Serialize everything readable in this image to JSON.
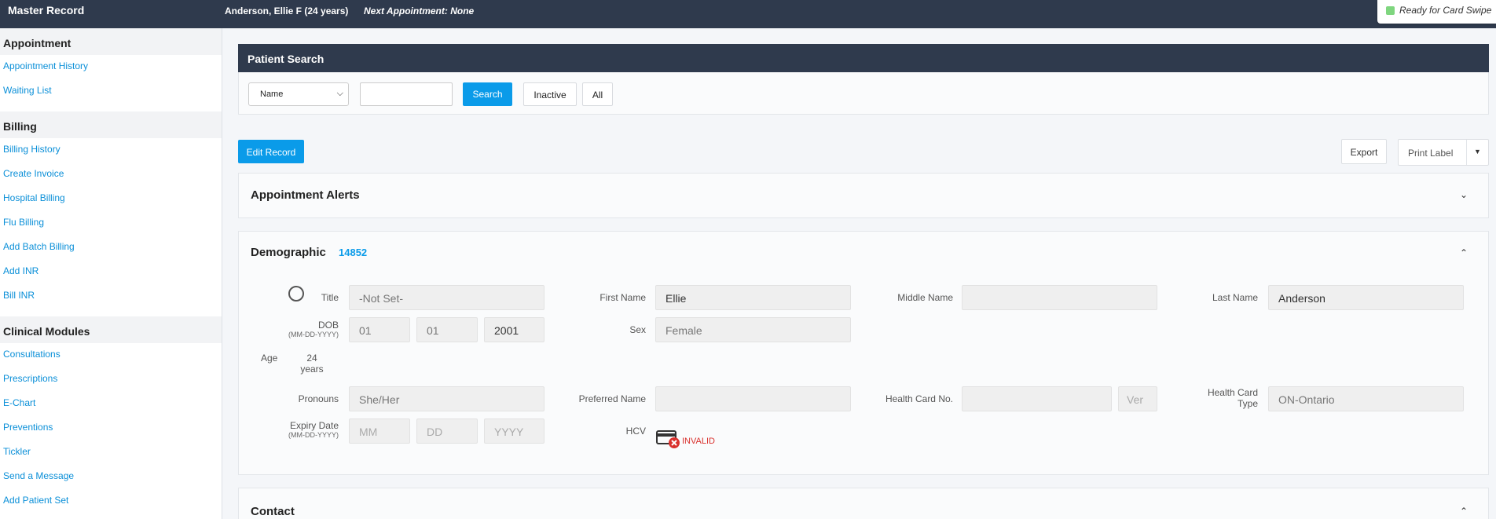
{
  "topbar": {
    "title": "Master Record",
    "patient": "Anderson, Ellie F (24 years)",
    "next_appointment": "Next Appointment: None",
    "card_swipe_status": "Ready for Card Swipe"
  },
  "sidebar": {
    "sections": [
      {
        "heading": "Appointment",
        "items": [
          "Appointment History",
          "Waiting List"
        ]
      },
      {
        "heading": "Billing",
        "items": [
          "Billing History",
          "Create Invoice",
          "Hospital Billing",
          "Flu Billing",
          "Add Batch Billing",
          "Add INR",
          "Bill INR"
        ]
      },
      {
        "heading": "Clinical Modules",
        "items": [
          "Consultations",
          "Prescriptions",
          "E-Chart",
          "Preventions",
          "Tickler",
          "Send a Message",
          "Add Patient Set"
        ]
      }
    ]
  },
  "search": {
    "title": "Patient Search",
    "select_value": "Name",
    "search_label": "Search",
    "inactive_label": "Inactive",
    "all_label": "All"
  },
  "actions": {
    "edit_label": "Edit Record",
    "export_label": "Export",
    "print_label": "Print Label"
  },
  "alerts": {
    "title": "Appointment Alerts"
  },
  "demographic": {
    "title": "Demographic",
    "id": "14852",
    "title_label": "Title",
    "title_value": "-Not Set-",
    "first_name_label": "First Name",
    "first_name": "Ellie",
    "middle_name_label": "Middle Name",
    "middle_name": "",
    "last_name_label": "Last Name",
    "last_name": "Anderson",
    "dob_label": "DOB",
    "dob_format": "(MM-DD-YYYY)",
    "dob_month": "01",
    "dob_day": "01",
    "dob_year": "2001",
    "sex_label": "Sex",
    "sex": "Female",
    "age_label": "Age",
    "age_value": "24",
    "age_unit": "years",
    "pronouns_label": "Pronouns",
    "pronouns": "She/Her",
    "preferred_name_label": "Preferred Name",
    "preferred_name": "",
    "health_card_label": "Health Card No.",
    "health_card_no": "",
    "ver_placeholder": "Ver",
    "health_card_type_label_1": "Health Card",
    "health_card_type_label_2": "Type",
    "health_card_type": "ON-Ontario",
    "expiry_label": "Expiry Date",
    "expiry_format": "(MM-DD-YYYY)",
    "expiry_mm": "MM",
    "expiry_dd": "DD",
    "expiry_yyyy": "YYYY",
    "hcv_label": "HCV",
    "hcv_status": "INVALID"
  },
  "contact": {
    "title": "Contact"
  },
  "colors": {
    "accent": "#0a9be9",
    "header": "#2f3a4d",
    "invalid": "#d9302c"
  },
  "icons": [
    "chevron-down-icon",
    "chevron-up-icon",
    "card-invalid-icon",
    "caret-down-icon"
  ]
}
